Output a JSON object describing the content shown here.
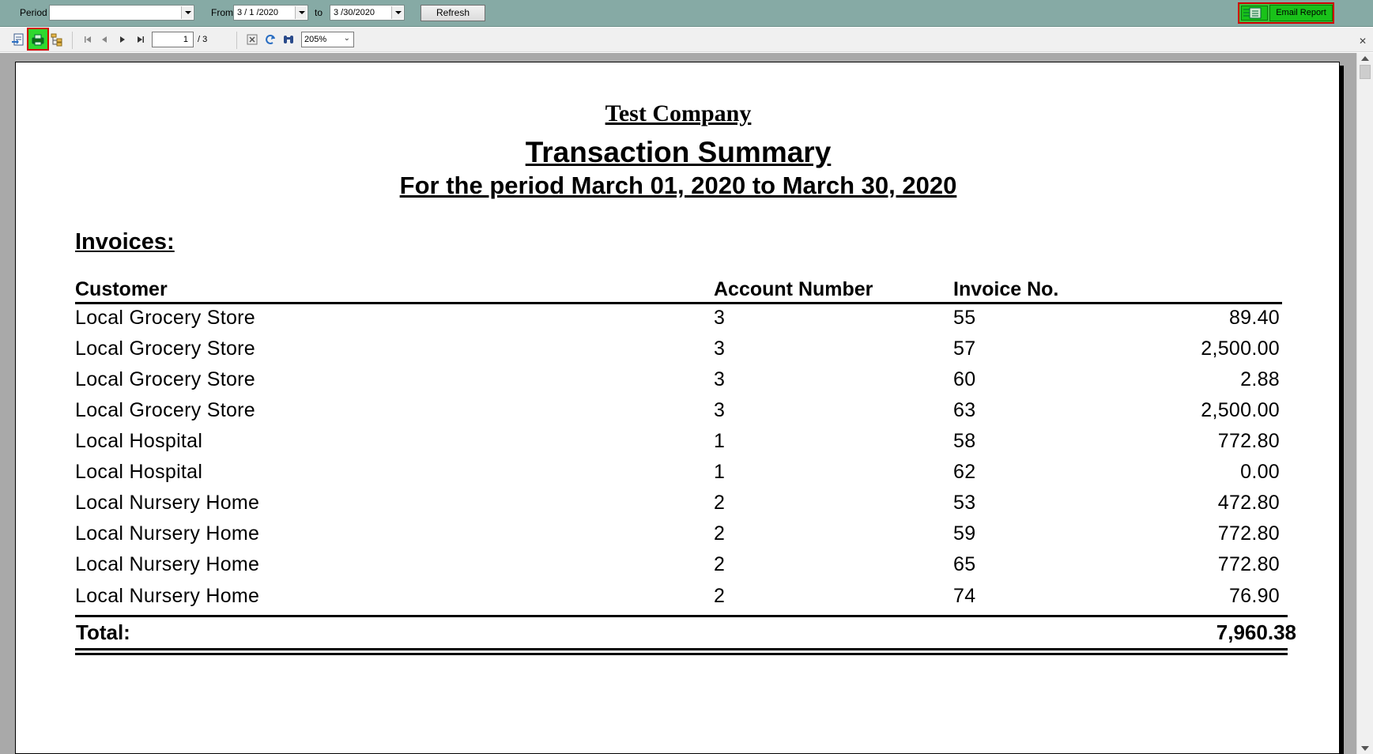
{
  "filter_bar": {
    "period_label": "Period",
    "period_value": "",
    "from_label": "From",
    "from_value": "3 / 1 /2020",
    "to_label": "to",
    "to_value": "3 /30/2020",
    "refresh_label": "Refresh",
    "email_label": "Email Report"
  },
  "toolbar": {
    "page_current": "1",
    "page_total": "/ 3",
    "zoom": "205%",
    "close_glyph": "✕"
  },
  "report": {
    "company": "Test Company",
    "title": "Transaction Summary",
    "period": "For the period March 01, 2020 to March 30, 2020",
    "section": "Invoices:",
    "headers": {
      "customer": "Customer",
      "account": "Account Number",
      "invoice": "Invoice No."
    },
    "rows": [
      {
        "customer": "Local Grocery Store",
        "account": "3",
        "invoice": "55",
        "amount": "89.40"
      },
      {
        "customer": "Local Grocery Store",
        "account": "3",
        "invoice": "57",
        "amount": "2,500.00"
      },
      {
        "customer": "Local Grocery Store",
        "account": "3",
        "invoice": "60",
        "amount": "2.88"
      },
      {
        "customer": "Local Grocery Store",
        "account": "3",
        "invoice": "63",
        "amount": "2,500.00"
      },
      {
        "customer": "Local Hospital",
        "account": "1",
        "invoice": "58",
        "amount": "772.80"
      },
      {
        "customer": "Local Hospital",
        "account": "1",
        "invoice": "62",
        "amount": "0.00"
      },
      {
        "customer": "Local Nursery Home",
        "account": "2",
        "invoice": "53",
        "amount": "472.80"
      },
      {
        "customer": "Local Nursery Home",
        "account": "2",
        "invoice": "59",
        "amount": "772.80"
      },
      {
        "customer": "Local Nursery Home",
        "account": "2",
        "invoice": "65",
        "amount": "772.80"
      },
      {
        "customer": "Local Nursery Home",
        "account": "2",
        "invoice": "74",
        "amount": "76.90"
      }
    ],
    "total_label": "Total:",
    "total_value": "7,960.38"
  },
  "colors": {
    "filter_bar_bg": "#86aaa5",
    "highlight_border": "#d00000",
    "email_button_bg": "#19c219",
    "viewport_bg": "#a9a9a9"
  }
}
